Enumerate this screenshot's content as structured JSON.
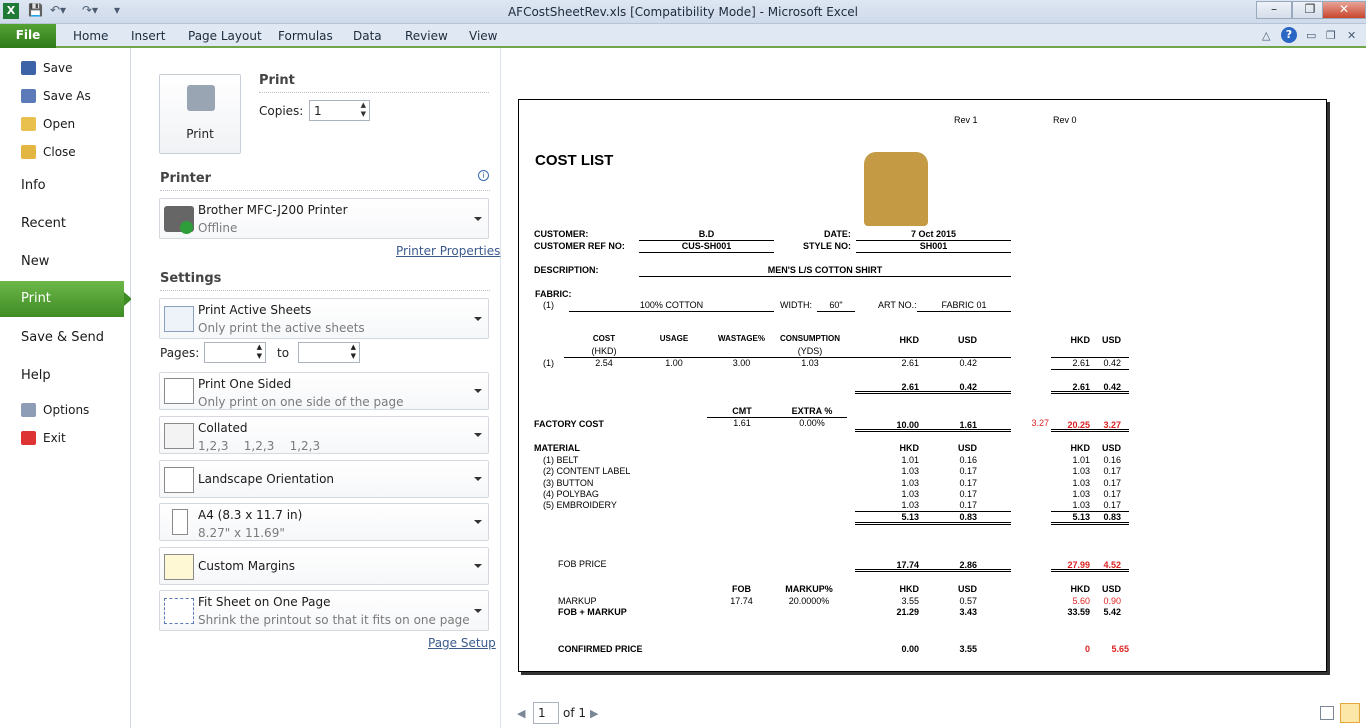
{
  "window": {
    "title": "AFCostSheetRev.xls  [Compatibility Mode]  -  Microsoft Excel"
  },
  "ribbon": {
    "file": "File",
    "tabs": [
      "Home",
      "Insert",
      "Page Layout",
      "Formulas",
      "Data",
      "Review",
      "View"
    ]
  },
  "nav": {
    "save": "Save",
    "save_as": "Save As",
    "open": "Open",
    "close": "Close",
    "info": "Info",
    "recent": "Recent",
    "new": "New",
    "print": "Print",
    "save_send": "Save & Send",
    "help": "Help",
    "options": "Options",
    "exit": "Exit"
  },
  "print": {
    "heading": "Print",
    "button": "Print",
    "copies_label": "Copies:",
    "copies_value": "1"
  },
  "printer": {
    "heading": "Printer",
    "name": "Brother MFC-J200 Printer",
    "status": "Offline",
    "properties": "Printer Properties"
  },
  "settings": {
    "heading": "Settings",
    "active": {
      "title": "Print Active Sheets",
      "desc": "Only print the active sheets"
    },
    "pages_label": "Pages:",
    "to_label": "to",
    "sided": {
      "title": "Print One Sided",
      "desc": "Only print on one side of the page"
    },
    "collated": {
      "title": "Collated",
      "desc": "1,2,3    1,2,3    1,2,3"
    },
    "orientation": {
      "title": "Landscape Orientation"
    },
    "paper": {
      "title": "A4 (8.3 x 11.7 in)",
      "desc": "8.27\" x 11.69\""
    },
    "margins": {
      "title": "Custom Margins"
    },
    "scaling": {
      "title": "Fit Sheet on One Page",
      "desc": "Shrink the printout so that it fits on one page"
    },
    "page_setup": "Page Setup"
  },
  "pager": {
    "page": "1",
    "of": "of 1"
  },
  "sheet": {
    "rev1": "Rev 1",
    "rev0": "Rev 0",
    "title": "COST LIST",
    "customer_label": "CUSTOMER:",
    "customer": "B.D",
    "date_label": "DATE:",
    "date": "7 Oct 2015",
    "custref_label": "CUSTOMER REF NO:",
    "custref": "CUS-SH001",
    "style_label": "STYLE NO:",
    "style": "SH001",
    "desc_label": "DESCRIPTION:",
    "desc": "MEN'S L/S COTTON SHIRT",
    "fabric_label": "FABRIC:",
    "fab_idx": "(1)",
    "fabric": "100% COTTON",
    "width_label": "WIDTH:",
    "width": "60\"",
    "artno_label": "ART NO.:",
    "artno": "FABRIC 01",
    "h_cost": "COST",
    "h_hkd_paren": "(HKD)",
    "h_usage": "USAGE",
    "h_wastage": "WASTAGE%",
    "h_cons": "CONSUMPTION",
    "h_yds": "(YDS)",
    "hkd": "HKD",
    "usd": "USD",
    "row1": {
      "idx": "(1)",
      "cost": "2.54",
      "usage": "1.00",
      "wastage": "3.00",
      "cons": "1.03",
      "hkd": "2.61",
      "usd": "0.42",
      "hkd2": "2.61",
      "usd2": "0.42"
    },
    "fab_total": {
      "hkd": "2.61",
      "usd": "0.42",
      "hkd2": "2.61",
      "usd2": "0.42"
    },
    "cmt_label": "CMT",
    "extra_label": "EXTRA %",
    "factory_label": "FACTORY COST",
    "cmt": "1.61",
    "extra": "0.00%",
    "factory_hkd": "10.00",
    "factory_usd": "1.61",
    "factory_note": "3.27",
    "factory_hkd2": "20.25",
    "factory_usd2": "3.27",
    "material_label": "MATERIAL",
    "materials": [
      {
        "name": "(1) BELT",
        "hkd": "1.01",
        "usd": "0.16",
        "hkd2": "1.01",
        "usd2": "0.16"
      },
      {
        "name": "(2) CONTENT LABEL",
        "hkd": "1.03",
        "usd": "0.17",
        "hkd2": "1.03",
        "usd2": "0.17"
      },
      {
        "name": "(3) BUTTON",
        "hkd": "1.03",
        "usd": "0.17",
        "hkd2": "1.03",
        "usd2": "0.17"
      },
      {
        "name": "(4) POLYBAG",
        "hkd": "1.03",
        "usd": "0.17",
        "hkd2": "1.03",
        "usd2": "0.17"
      },
      {
        "name": "(5) EMBROIDERY",
        "hkd": "1.03",
        "usd": "0.17",
        "hkd2": "1.03",
        "usd2": "0.17"
      }
    ],
    "mat_total": {
      "hkd": "5.13",
      "usd": "0.83",
      "hkd2": "5.13",
      "usd2": "0.83"
    },
    "fob_label": "FOB PRICE",
    "fob": {
      "hkd": "17.74",
      "usd": "2.86",
      "hkd2": "27.99",
      "usd2": "4.52"
    },
    "h_fob": "FOB",
    "h_markup": "MARKUP%",
    "markup_label": "MARKUP",
    "fob_val": "17.74",
    "markup_pct": "20.0000%",
    "markup": {
      "hkd": "3.55",
      "usd": "0.57",
      "hkd2": "5.60",
      "usd2": "0.90"
    },
    "fobmarkup_label": "FOB + MARKUP",
    "fobmarkup": {
      "hkd": "21.29",
      "usd": "3.43",
      "hkd2": "33.59",
      "usd2": "5.42"
    },
    "confirmed_label": "CONFIRMED PRICE",
    "confirmed": {
      "hkd": "0.00",
      "usd": "3.55",
      "hkd2": "0",
      "usd2": "5.65"
    }
  }
}
